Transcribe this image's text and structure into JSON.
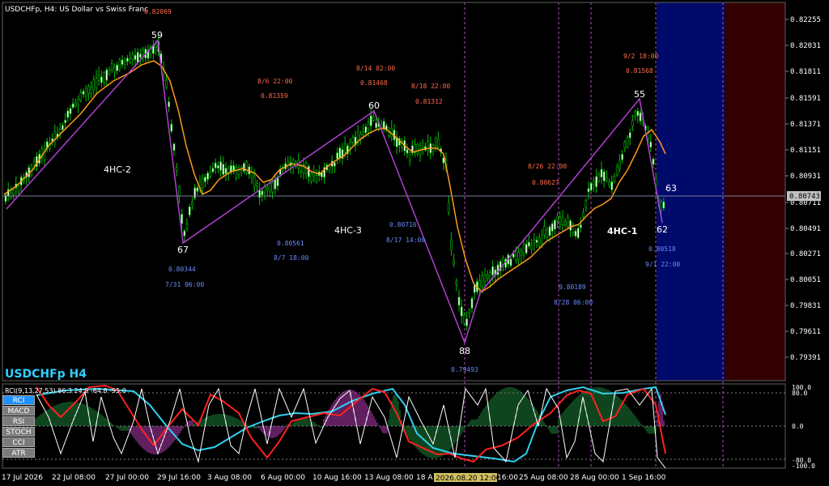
{
  "chart_header": "USDCHFp, H4:  US Dollar vs Swiss Franc",
  "symbol_big": "USDCHFp H4",
  "current_price": "0.80743",
  "price_axis": [
    "0.82255",
    "0.82031",
    "0.81811",
    "0.81591",
    "0.81371",
    "0.81151",
    "0.80931",
    "0.80711",
    "0.80491",
    "0.80271",
    "0.80051",
    "0.79831",
    "0.79611",
    "0.79391"
  ],
  "time_axis": [
    "17 Jul 2026",
    "22 Jul 08:00",
    "27 Jul 00:00",
    "29 Jul 16:00",
    "3 Aug 08:00",
    "6 Aug 00:00",
    "10 Aug 16:00",
    "13 Aug 08:00",
    "18 Aug 00:00",
    "2026.08.20 12:00",
    "16:00",
    "25 Aug 08:00",
    "28 Aug 00:00",
    "1 Sep 16:00"
  ],
  "time_highlight": "2026.08.20 12:00",
  "pivot_numbers": [
    "59",
    "67",
    "60",
    "88",
    "55",
    "62",
    "63"
  ],
  "wave_labels": [
    "4HC-2",
    "4HC-3",
    "4HC-1"
  ],
  "annotations": {
    "top_price": "0.82069",
    "a86_date": "8/6 22:00",
    "a86_price": "0.81359",
    "a814_date": "8/14 02:00",
    "a814_price": "0.81468",
    "a818_date": "8/18 22:00",
    "a818_price": "0.81312",
    "a92_date": "9/2 18:00",
    "a92_price": "0.81568",
    "a826_date": "8/26 22:00",
    "a826_price": "0.80627",
    "b731_price": "0.80344",
    "b731_date": "7/31 06:00",
    "b87_price": "0.80561",
    "b87_date": "8/7 18:00",
    "b817_price": "0.80716",
    "b817_date": "8/17 14:00",
    "b828_price": "0.80189",
    "b828_date": "8/28 06:00",
    "b91_price": "0.80518",
    "b91_date": "9/1 22:00",
    "b_low_price": "0.79493"
  },
  "indicator": {
    "title": "RCI(9,13,27,53) 86.3 24.9 -64.8 -95.0",
    "scale": [
      "100.0",
      "80.0",
      "0.0",
      "-80.0",
      "-100.0"
    ]
  },
  "indicator_buttons": [
    "RCI",
    "MACD",
    "RSI",
    "STOCH",
    "CCI",
    "ATR"
  ],
  "colors": {
    "background": "#000000",
    "bull_candle": "#00c000",
    "zigzag": "#b040d0",
    "ma": "#ff9a1a",
    "bid_line": "#7a7f9a",
    "session_blue": "#000a6a",
    "session_red": "#320000",
    "rci_fast": "#ffffff",
    "rci_red": "#ff2020",
    "rci_cyan": "#30d0f0",
    "hist_green": "#1e8a3c",
    "hist_magenta": "#c040c0",
    "annotation_red": "#ff6a4a",
    "annotation_blue": "#6a8aff"
  }
}
